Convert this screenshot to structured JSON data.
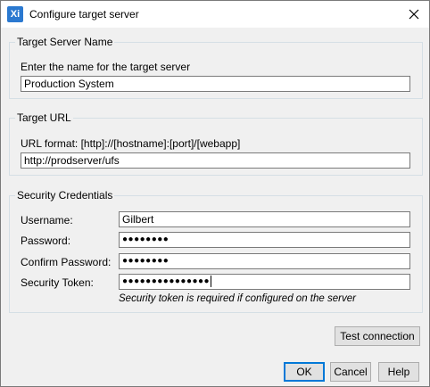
{
  "window": {
    "title": "Configure target server",
    "app_icon": "Xi"
  },
  "target_server_name": {
    "legend": "Target Server Name",
    "prompt": "Enter the name for the target server",
    "value": "Production System"
  },
  "target_url": {
    "legend": "Target URL",
    "format": "URL format: [http]://[hostname]:[port]/[webapp]",
    "value": "http://prodserver/ufs"
  },
  "security": {
    "legend": "Security Credentials",
    "username_label": "Username:",
    "username_value": "Gilbert",
    "password_label": "Password:",
    "password_value": "●●●●●●●●",
    "confirm_label": "Confirm Password:",
    "confirm_value": "●●●●●●●●",
    "token_label": "Security Token:",
    "token_value": "●●●●●●●●●●●●●●●",
    "token_hint": "Security token is required if configured on the server"
  },
  "buttons": {
    "test": "Test connection",
    "ok": "OK",
    "cancel": "Cancel",
    "help": "Help"
  },
  "icons": {
    "close": "close-icon",
    "app": "app-icon"
  }
}
